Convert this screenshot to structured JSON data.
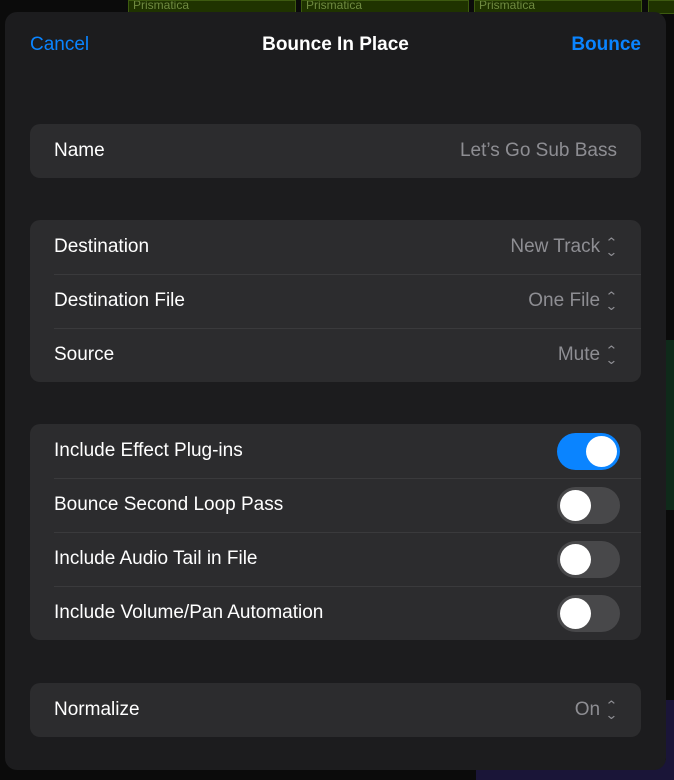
{
  "background": {
    "region_label": "Prismatica"
  },
  "nav": {
    "cancel": "Cancel",
    "title": "Bounce In Place",
    "bounce": "Bounce"
  },
  "name": {
    "label": "Name",
    "value": "Let’s Go Sub Bass"
  },
  "destination_group": [
    {
      "label": "Destination",
      "value": "New Track"
    },
    {
      "label": "Destination File",
      "value": "One File"
    },
    {
      "label": "Source",
      "value": "Mute"
    }
  ],
  "toggles": [
    {
      "label": "Include Effect Plug-ins",
      "on": true
    },
    {
      "label": "Bounce Second Loop Pass",
      "on": false
    },
    {
      "label": "Include Audio Tail in File",
      "on": false
    },
    {
      "label": "Include Volume/Pan Automation",
      "on": false
    }
  ],
  "normalize": {
    "label": "Normalize",
    "value": "On"
  },
  "colors": {
    "accent": "#0a84ff",
    "sheet": "#1c1c1e",
    "group": "#2c2c2e"
  }
}
